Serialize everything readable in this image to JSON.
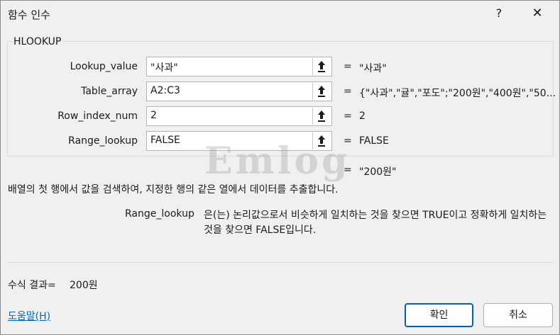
{
  "dialog": {
    "title": "함수 인수",
    "help_glyph": "?",
    "close_glyph": "✕"
  },
  "function": {
    "name": "HLOOKUP",
    "args": [
      {
        "label": "Lookup_value",
        "input": "\"사과\"",
        "result": "\"사과\""
      },
      {
        "label": "Table_array",
        "input": "A2:C3",
        "result": "{\"사과\",\"귤\",\"포도\";\"200원\",\"400원\",\"50..."
      },
      {
        "label": "Row_index_num",
        "input": "2",
        "result": "2"
      },
      {
        "label": "Range_lookup",
        "input": "FALSE",
        "result": "FALSE"
      }
    ],
    "equals": "=",
    "formula_value": "\"200원\"",
    "description": "배열의 첫 행에서 값을 검색하여, 지정한 행의 같은 열에서 데이터를 추출합니다.",
    "arg_help_name": "Range_lookup",
    "arg_help_text": "은(는) 논리값으로서 비슷하게 일치하는 것을 찾으면 TRUE이고 정확하게 일치하는 것을 찾으면 FALSE입니다."
  },
  "watermark": "Emlog",
  "result": {
    "label": "수식 결과=",
    "value": "200원"
  },
  "footer": {
    "help_link": "도움말(H)",
    "ok_label": "확인",
    "cancel_label": "취소"
  },
  "icons": {
    "ref_button": "collapse-dialog-arrow-icon"
  },
  "colors": {
    "accent": "#005fb8",
    "link": "#0067c0",
    "background": "#f0f0f0"
  }
}
